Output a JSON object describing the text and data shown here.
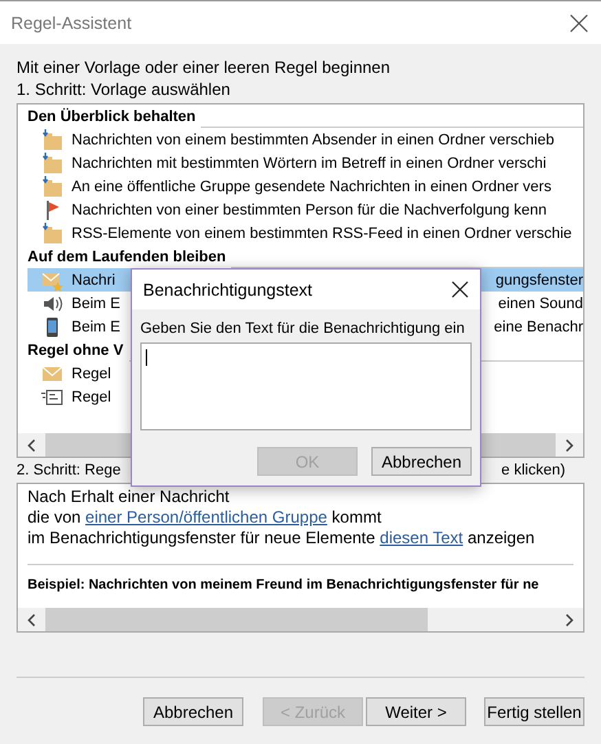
{
  "window": {
    "title": "Regel-Assistent"
  },
  "intro": "Mit einer Vorlage oder einer leeren Regel beginnen",
  "step1_label": "1. Schritt: Vorlage auswählen",
  "template_groups": [
    {
      "heading": "Den Überblick behalten",
      "items": [
        {
          "kind": "folder-move",
          "text": "Nachrichten von einem bestimmten Absender in einen Ordner verschieb",
          "selected": false
        },
        {
          "kind": "folder-move",
          "text": "Nachrichten mit bestimmten Wörtern im Betreff in einen Ordner verschi",
          "selected": false
        },
        {
          "kind": "folder-move",
          "text": "An eine öffentliche Gruppe gesendete Nachrichten in einen Ordner vers",
          "selected": false
        },
        {
          "kind": "flag",
          "text": "Nachrichten von einer bestimmten Person für die Nachverfolgung kenn",
          "selected": false
        },
        {
          "kind": "folder-move",
          "text": "RSS-Elemente von einem bestimmten RSS-Feed in einen Ordner verschie",
          "selected": false
        }
      ]
    },
    {
      "heading": "Auf dem Laufenden bleiben",
      "items": [
        {
          "kind": "envelope-star",
          "text": "Nachri",
          "text_after": "gungsfenster",
          "selected": true
        },
        {
          "kind": "speaker",
          "text": "Beim E",
          "text_after": "einen Sound",
          "selected": false
        },
        {
          "kind": "phone",
          "text": "Beim E",
          "text_after": "eine Benachr",
          "selected": false
        }
      ]
    },
    {
      "heading": "Regel ohne V",
      "items": [
        {
          "kind": "envelope",
          "text": "Regel",
          "selected": false
        },
        {
          "kind": "envelope-lines",
          "text": "Regel",
          "selected": false
        }
      ]
    }
  ],
  "step2_label": {
    "text": "2. Schritt: Rege",
    "text_after": "e klicken)"
  },
  "rule_description": {
    "lines": [
      [
        {
          "text": "Nach Erhalt einer Nachricht"
        }
      ],
      [
        {
          "text": "die von "
        },
        {
          "text": "einer Person/öffentlichen Gruppe",
          "kind": "link"
        },
        {
          "text": " kommt"
        }
      ],
      [
        {
          "text": "im Benachrichtigungsfenster für neue Elemente "
        },
        {
          "text": "diesen Text",
          "kind": "link"
        },
        {
          "text": " anzeigen"
        }
      ]
    ],
    "example": "Beispiel: Nachrichten von meinem Freund im Benachrichtigungsfenster für ne"
  },
  "buttons": [
    {
      "label": "Abbrechen",
      "disabled": false
    },
    {
      "label": "< Zurück",
      "disabled": true
    },
    {
      "label": "Weiter >",
      "disabled": false
    },
    {
      "label": "Fertig stellen",
      "disabled": false
    }
  ],
  "dialog": {
    "title": "Benachrichtigungstext",
    "prompt": "Geben Sie den Text für die Benachrichtigung ein",
    "buttons": [
      {
        "label": "OK",
        "disabled": true
      },
      {
        "label": "Abbrechen",
        "disabled": false
      }
    ]
  }
}
